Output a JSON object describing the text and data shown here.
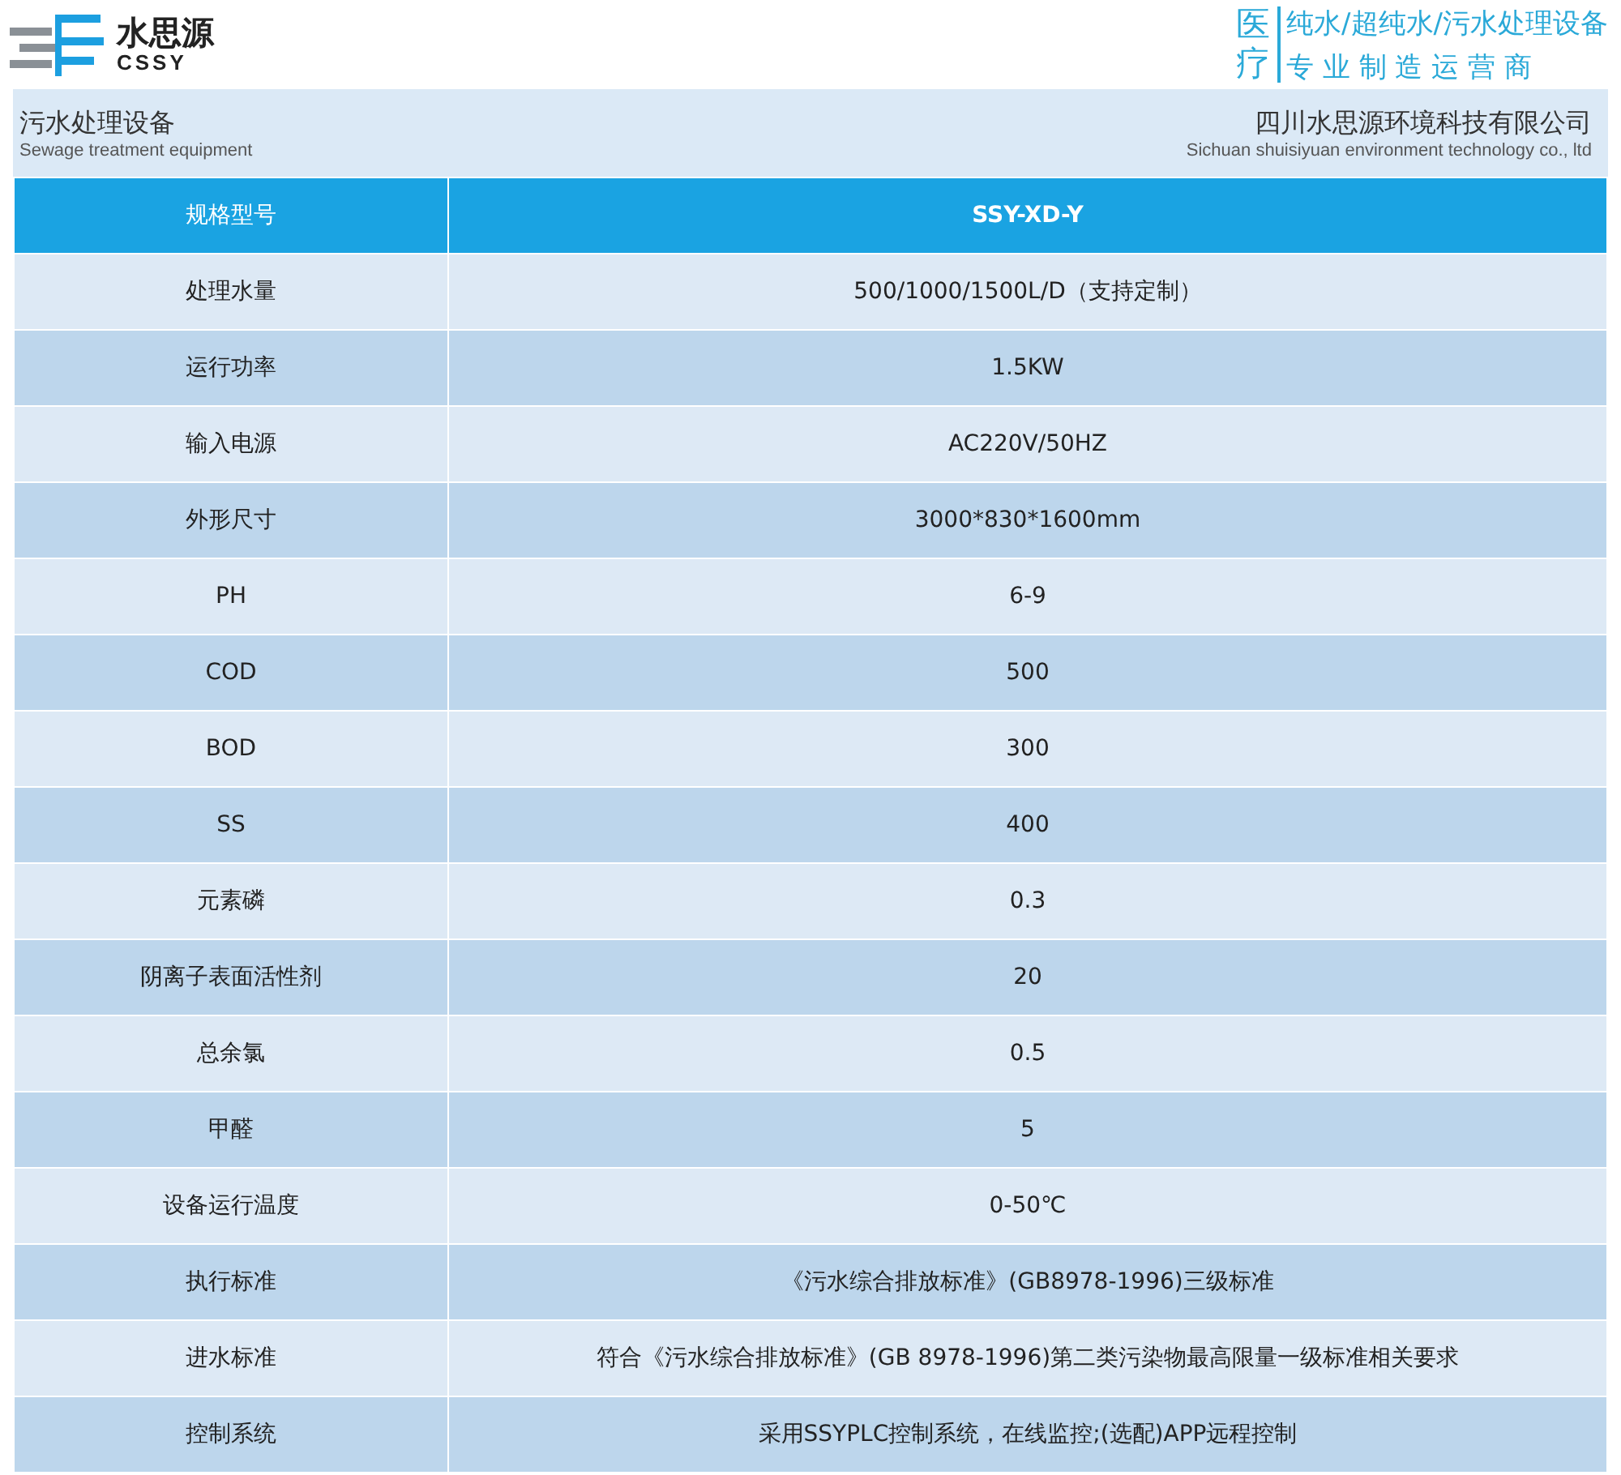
{
  "brand": {
    "name": "水思源",
    "latin": "CSSY"
  },
  "slogan": {
    "badge": "医疗",
    "lines": [
      "纯水/超纯水/污水处理设备",
      "专 业 制 造 运 营 商"
    ]
  },
  "info": {
    "title": "污水处理设备",
    "subtitle": "Sewage treatment equipment",
    "company": "四川水思源环境科技有限公司",
    "company_en": "Sichuan shuisiyuan environment technology co., ltd"
  },
  "table": {
    "columns": [
      "规格型号",
      "SSY-XD-Y"
    ],
    "rows": [
      [
        "处理水量",
        "500/1000/1500L/D（支持定制）"
      ],
      [
        "运行功率",
        "1.5KW"
      ],
      [
        "输入电源",
        "AC220V/50HZ"
      ],
      [
        "外形尺寸",
        "3000*830*1600mm"
      ],
      [
        "PH",
        "6-9"
      ],
      [
        "COD",
        "500"
      ],
      [
        "BOD",
        "300"
      ],
      [
        "SS",
        "400"
      ],
      [
        "元素磷",
        "0.3"
      ],
      [
        "阴离子表面活性剂",
        "20"
      ],
      [
        "总余氯",
        "0.5"
      ],
      [
        "甲醛",
        "5"
      ],
      [
        "设备运行温度",
        "0-50℃"
      ],
      [
        "执行标准",
        "《污水综合排放标准》(GB8978-1996)三级标准"
      ],
      [
        "进水标准",
        "符合《污水综合排放标准》(GB 8978-1996)第二类污染物最高限量一级标准相关要求"
      ],
      [
        "控制系统",
        "采用SSYPLC控制系统，在线监控;(选配)APP远程控制"
      ]
    ]
  }
}
